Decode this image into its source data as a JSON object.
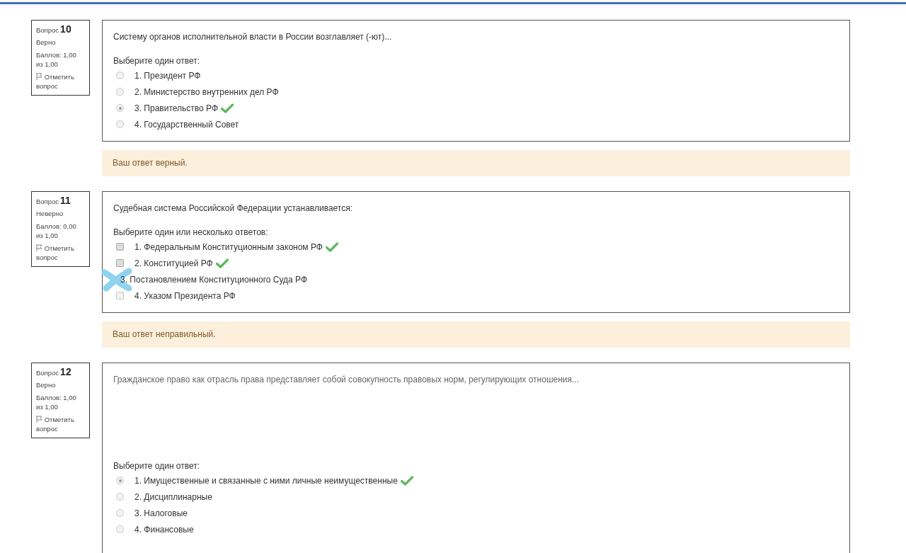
{
  "questions": [
    {
      "label": "Вопрос",
      "number": "10",
      "status": "Верно",
      "score": "Баллов: 1,00 из 1,00",
      "flag": "Отметить вопрос",
      "text": "Систему органов исполнительной власти в России возглавляет (-ют)...",
      "prompt": "Выберите один ответ:",
      "options": [
        {
          "kind": "radio",
          "text": "1. Президент РФ",
          "selected": false,
          "correct": false
        },
        {
          "kind": "radio",
          "text": "2. Министерство внутренних дел РФ",
          "selected": false,
          "correct": false
        },
        {
          "kind": "radio",
          "text": "3. Правительство РФ",
          "selected": true,
          "correct": true
        },
        {
          "kind": "radio",
          "text": "4. Государственный Совет",
          "selected": false,
          "correct": false
        }
      ],
      "feedback": "Ваш ответ верный."
    },
    {
      "label": "Вопрос",
      "number": "11",
      "status": "Неверно",
      "score": "Баллов: 0,00 из 1,00",
      "flag": "Отметить вопрос",
      "text": "Судебная система Российской Федерации устанавливается:",
      "prompt": "Выберите один или несколько ответов:",
      "options": [
        {
          "kind": "checkbox",
          "text": "1. Федеральным Конституционным законом РФ",
          "selected": true,
          "correct": true
        },
        {
          "kind": "checkbox",
          "text": "2. Конституцией РФ",
          "selected": true,
          "correct": true
        },
        {
          "kind": "scribbled",
          "text": "3. Постановлением Конституционного Суда РФ",
          "correct": false
        },
        {
          "kind": "checkbox",
          "text": "4. Указом Президента РФ",
          "selected": false,
          "correct": false
        }
      ],
      "feedback": "Ваш ответ неправильный."
    },
    {
      "label": "Вопрос",
      "number": "12",
      "status": "Верно",
      "score": "Баллов: 1,00 из 1,00",
      "flag": "Отметить вопрос",
      "text": "Гражданское право как отрасль права представляет собой совокупность правовых норм, регулирующих отношения...",
      "prompt": "Выберите один ответ:",
      "options": [
        {
          "kind": "radio",
          "text": "1. Имущественные и связанные с ними личные неимущественные",
          "selected": true,
          "correct": true
        },
        {
          "kind": "radio",
          "text": "2. Дисциплинарные",
          "selected": false,
          "correct": false
        },
        {
          "kind": "radio",
          "text": "3. Налоговые",
          "selected": false,
          "correct": false
        },
        {
          "kind": "radio",
          "text": "4. Финансовые",
          "selected": false,
          "correct": false
        }
      ]
    }
  ]
}
